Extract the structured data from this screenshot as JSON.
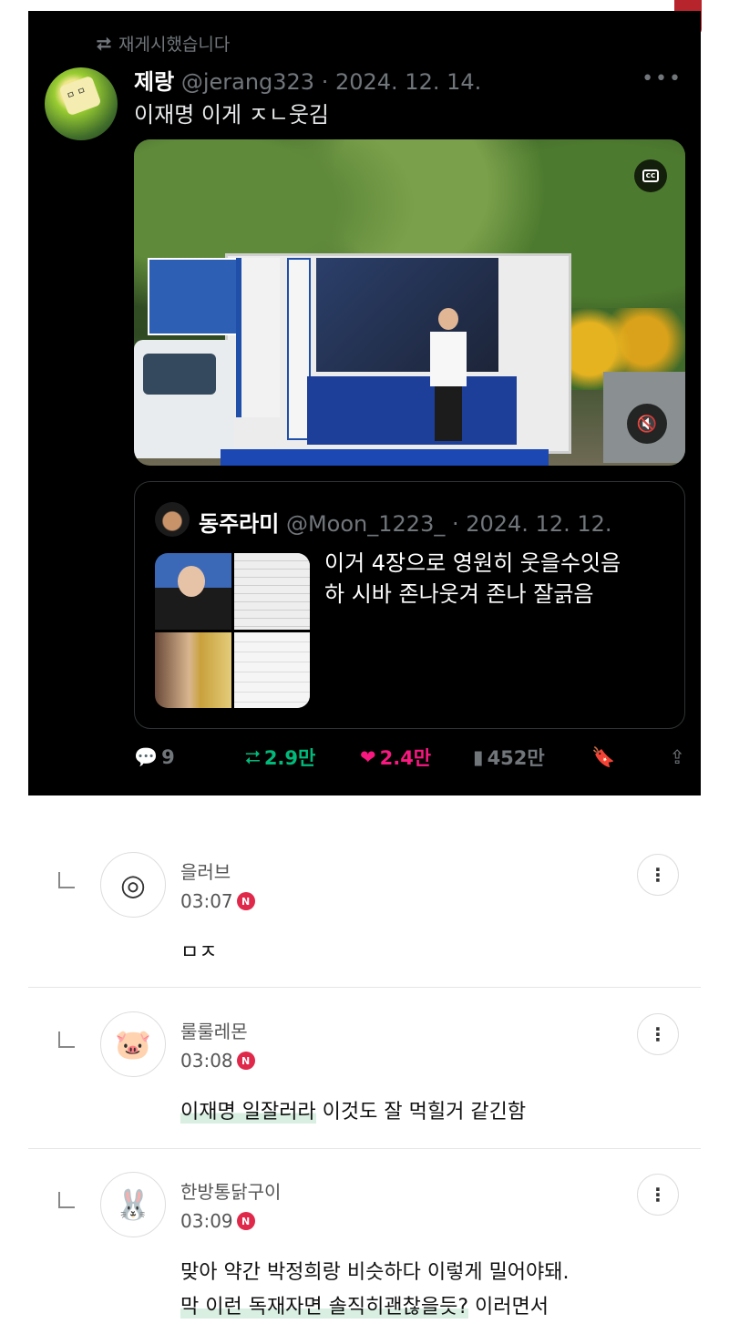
{
  "tweet": {
    "repost_label": "재게시했습니다",
    "author_name": "제랑",
    "author_handle_date": "@jerang323 · 2024. 12. 14.",
    "text": "이재명 이게 ㅈㄴ웃김",
    "video": {
      "cc_label": "cc"
    },
    "quote": {
      "author_name": "동주라미",
      "author_handle_date": "@Moon_1223_ · 2024. 12. 12.",
      "text": "이거 4장으로 영원히 웃을수잇음\n하 시바 존나웃겨 존나 잘긁음"
    },
    "actions": {
      "replies": "9",
      "reposts": "2.9만",
      "likes": "2.4만",
      "views": "452만"
    }
  },
  "comments": [
    {
      "name": "을러브",
      "time": "03:07",
      "badge": "N",
      "body": "ㅁㅈ",
      "highlight": "",
      "rest": ""
    },
    {
      "name": "룰룰레몬",
      "time": "03:08",
      "badge": "N",
      "body": "",
      "highlight": "이재명 일잘러라",
      "rest": " 이것도 잘 먹힐거 같긴함"
    },
    {
      "name": "한방통닭구이",
      "time": "03:09",
      "badge": "N",
      "body": "맞아 약간 박정희랑 비슷하다 이렇게 밀어야돼.",
      "highlight": "막 이런 독재자면 솔직히괜찮을듯?",
      "rest": " 이러면서"
    }
  ]
}
